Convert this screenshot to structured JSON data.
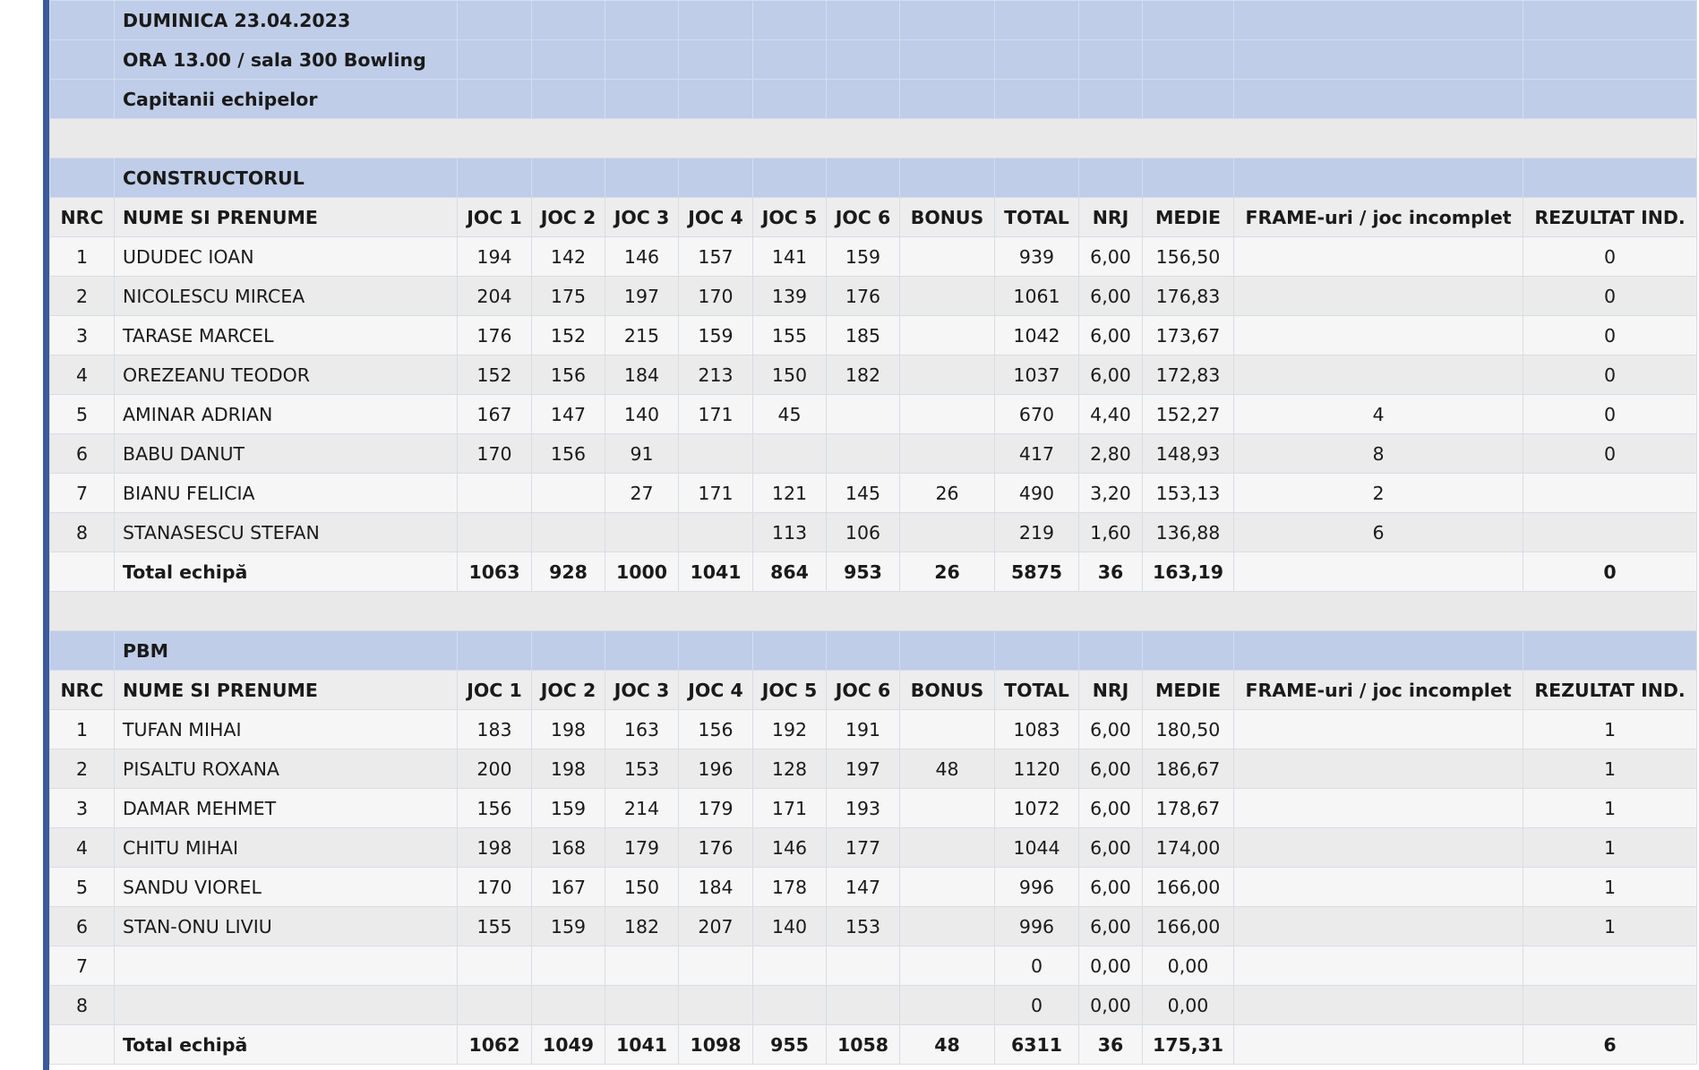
{
  "header": {
    "date": "DUMINICA 23.04.2023",
    "location": "ORA 13.00 / sala 300 Bowling",
    "subtitle": "Capitanii echipelor"
  },
  "columns": [
    "NRC",
    "NUME SI PRENUME",
    "JOC 1",
    "JOC 2",
    "JOC 3",
    "JOC 4",
    "JOC 5",
    "JOC 6",
    "BONUS",
    "TOTAL",
    "NRJ",
    "MEDIE",
    "FRAME-uri / joc incomplet",
    "REZULTAT IND."
  ],
  "teams": [
    {
      "name": "CONSTRUCTORUL",
      "rows": [
        [
          "1",
          "UDUDEC IOAN",
          "194",
          "142",
          "146",
          "157",
          "141",
          "159",
          "",
          "939",
          "6,00",
          "156,50",
          "",
          "0"
        ],
        [
          "2",
          "NICOLESCU MIRCEA",
          "204",
          "175",
          "197",
          "170",
          "139",
          "176",
          "",
          "1061",
          "6,00",
          "176,83",
          "",
          "0"
        ],
        [
          "3",
          "TARASE MARCEL",
          "176",
          "152",
          "215",
          "159",
          "155",
          "185",
          "",
          "1042",
          "6,00",
          "173,67",
          "",
          "0"
        ],
        [
          "4",
          "OREZEANU TEODOR",
          "152",
          "156",
          "184",
          "213",
          "150",
          "182",
          "",
          "1037",
          "6,00",
          "172,83",
          "",
          "0"
        ],
        [
          "5",
          "AMINAR ADRIAN",
          "167",
          "147",
          "140",
          "171",
          "45",
          "",
          "",
          "670",
          "4,40",
          "152,27",
          "4",
          "0"
        ],
        [
          "6",
          "BABU DANUT",
          "170",
          "156",
          "91",
          "",
          "",
          "",
          "",
          "417",
          "2,80",
          "148,93",
          "8",
          "0"
        ],
        [
          "7",
          "BIANU FELICIA",
          "",
          "",
          "27",
          "171",
          "121",
          "145",
          "26",
          "490",
          "3,20",
          "153,13",
          "2",
          ""
        ],
        [
          "8",
          "STANASESCU STEFAN",
          "",
          "",
          "",
          "",
          "113",
          "106",
          "",
          "219",
          "1,60",
          "136,88",
          "6",
          ""
        ]
      ],
      "total": [
        "",
        "Total echipă",
        "1063",
        "928",
        "1000",
        "1041",
        "864",
        "953",
        "26",
        "5875",
        "36",
        "163,19",
        "",
        "0"
      ]
    },
    {
      "name": "PBM",
      "rows": [
        [
          "1",
          "TUFAN MIHAI",
          "183",
          "198",
          "163",
          "156",
          "192",
          "191",
          "",
          "1083",
          "6,00",
          "180,50",
          "",
          "1"
        ],
        [
          "2",
          "PISALTU ROXANA",
          "200",
          "198",
          "153",
          "196",
          "128",
          "197",
          "48",
          "1120",
          "6,00",
          "186,67",
          "",
          "1"
        ],
        [
          "3",
          "DAMAR MEHMET",
          "156",
          "159",
          "214",
          "179",
          "171",
          "193",
          "",
          "1072",
          "6,00",
          "178,67",
          "",
          "1"
        ],
        [
          "4",
          "CHITU MIHAI",
          "198",
          "168",
          "179",
          "176",
          "146",
          "177",
          "",
          "1044",
          "6,00",
          "174,00",
          "",
          "1"
        ],
        [
          "5",
          "SANDU VIOREL",
          "170",
          "167",
          "150",
          "184",
          "178",
          "147",
          "",
          "996",
          "6,00",
          "166,00",
          "",
          "1"
        ],
        [
          "6",
          "STAN-ONU LIVIU",
          "155",
          "159",
          "182",
          "207",
          "140",
          "153",
          "",
          "996",
          "6,00",
          "166,00",
          "",
          "1"
        ],
        [
          "7",
          "",
          "",
          "",
          "",
          "",
          "",
          "",
          "",
          "0",
          "0,00",
          "0,00",
          "",
          ""
        ],
        [
          "8",
          "",
          "",
          "",
          "",
          "",
          "",
          "",
          "",
          "0",
          "0,00",
          "0,00",
          "",
          ""
        ]
      ],
      "total": [
        "",
        "Total echipă",
        "1062",
        "1049",
        "1041",
        "1098",
        "955",
        "1058",
        "48",
        "6311",
        "36",
        "175,31",
        "",
        "6"
      ]
    }
  ],
  "colors": {
    "header_blue": "#bfcde8",
    "left_accent": "#3a5a9a",
    "row_light": "#f6f6f6",
    "row_dark": "#ebebeb"
  }
}
